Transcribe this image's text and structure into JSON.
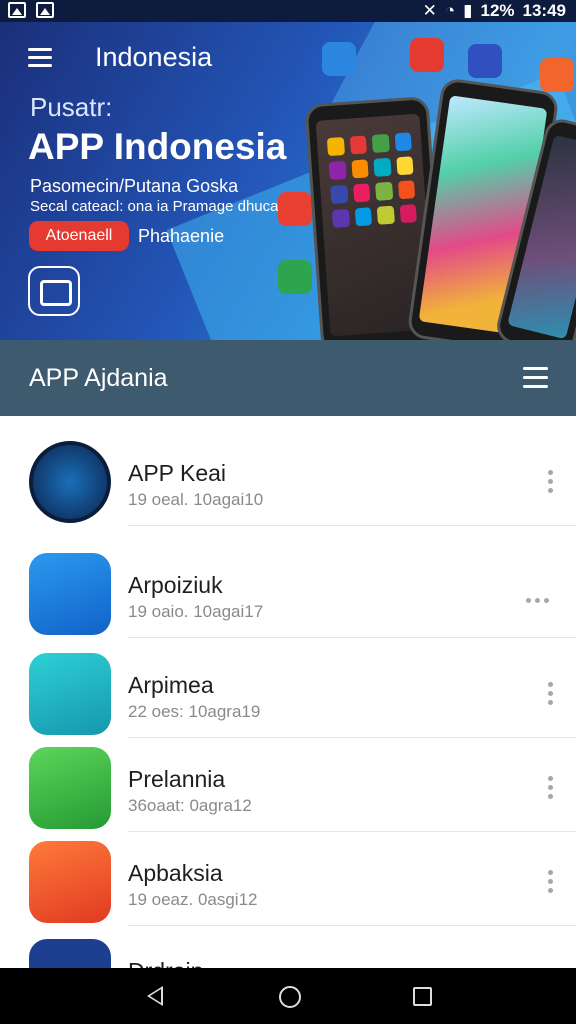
{
  "status_bar": {
    "battery": "12%",
    "time": "13:49"
  },
  "hero": {
    "header_title": "Indonesia",
    "pre_title": "Pusatr:",
    "main_title": "APP Indonesia",
    "subtitle_line1": "Pasomecin/Putana Goska",
    "subtitle_line2": "Secal cateacl: ona ia Pramage dhuca",
    "primary_button": "Atoenaell",
    "secondary_link": "Phahaenie"
  },
  "section": {
    "title": "APP Ajdania"
  },
  "apps": [
    {
      "name": "APP Keai",
      "meta": "19 oeal. 10agai10",
      "icon": "globe-icon",
      "color": "#0f2a5a"
    },
    {
      "name": "Arpoiziuk",
      "meta": "19 oaio. 10agai17",
      "icon": "chat-icon",
      "color": "#1e80e0"
    },
    {
      "name": "Arpimea",
      "meta": "22 oes: 10agra19",
      "icon": "wave-icon",
      "color": "#1fb5c7"
    },
    {
      "name": "Prelannia",
      "meta": "36oaat: 0agra12",
      "icon": "mail-icon",
      "color": "#3cc24a"
    },
    {
      "name": "Apbaksia",
      "meta": "19 oeaz. 0asgi12",
      "icon": "photo-icon",
      "color": "#f0532a"
    },
    {
      "name": "Drdrain",
      "meta": "",
      "icon": "app-icon",
      "color": "#1d3f8f"
    }
  ]
}
